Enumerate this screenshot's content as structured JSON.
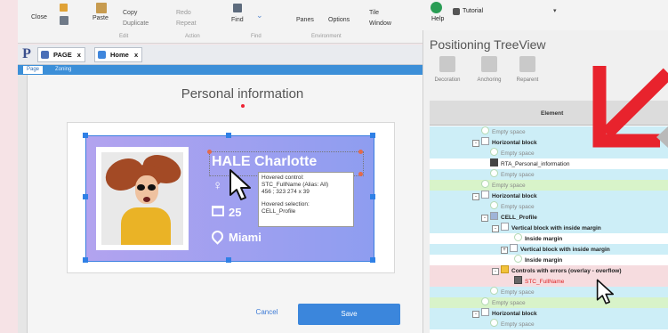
{
  "ribbon": {
    "close": "Close",
    "paste": "Paste",
    "copy": "Copy",
    "duplicate": "Duplicate",
    "redo": "Redo",
    "repeat": "Repeat",
    "find": "Find",
    "panes": "Panes",
    "options": "Options",
    "tile": "Tile",
    "window": "Window",
    "groups": {
      "edit": "Edit",
      "action": "Action",
      "find": "Find",
      "environment": "Environment"
    }
  },
  "tabs": {
    "logo": "P",
    "page_tab": "PAGE",
    "home_tab": "Home",
    "close_glyph": "x"
  },
  "subtabs": {
    "page": "Page",
    "zoning": "Zoning"
  },
  "editor": {
    "page_title": "Personal information",
    "card": {
      "name": "HALE Charlotte",
      "gender_icon": "♀",
      "age": "25",
      "city": "Miami"
    },
    "tooltip": {
      "line1": "Hovered control:",
      "line2": "STC_FullName (Alias: All)",
      "line3": "456 ; 323    274 x 39",
      "line4": "Hovered selection:",
      "line5": "CELL_Profile"
    },
    "cancel": "Cancel",
    "save": "Save"
  },
  "right_panel": {
    "help": "Help",
    "tutorial": "Tutorial",
    "dropdown_glyph": "▾",
    "title": "Positioning TreeView",
    "toolbar": [
      "Decoration",
      "Anchoring",
      "Reparent"
    ],
    "column_header": "Element",
    "rows": [
      {
        "text": "Empty space"
      },
      {
        "text": "Horizontal block"
      },
      {
        "text": "Empty space"
      },
      {
        "text": "RTA_Personal_information"
      },
      {
        "text": "Empty space"
      },
      {
        "text": "Empty space"
      },
      {
        "text": "Horizontal block"
      },
      {
        "text": "Empty space"
      },
      {
        "text": "CELL_Profile"
      },
      {
        "text": "Vertical block with inside margin"
      },
      {
        "text": "Inside margin"
      },
      {
        "text": "Vertical block with inside margin"
      },
      {
        "text": "Inside margin"
      },
      {
        "text": "Controls with errors (overlay - overflow)"
      },
      {
        "text": "STC_FullName"
      },
      {
        "text": "Empty space"
      },
      {
        "text": "Empty space"
      },
      {
        "text": "Horizontal block"
      },
      {
        "text": "Empty space"
      }
    ]
  },
  "colors": {
    "accent_blue": "#3b86dc",
    "row_cyan": "#cdeef7",
    "row_green": "#d8f3c9",
    "row_pink": "#f6dcdf",
    "arrow_red": "#e8232d"
  }
}
